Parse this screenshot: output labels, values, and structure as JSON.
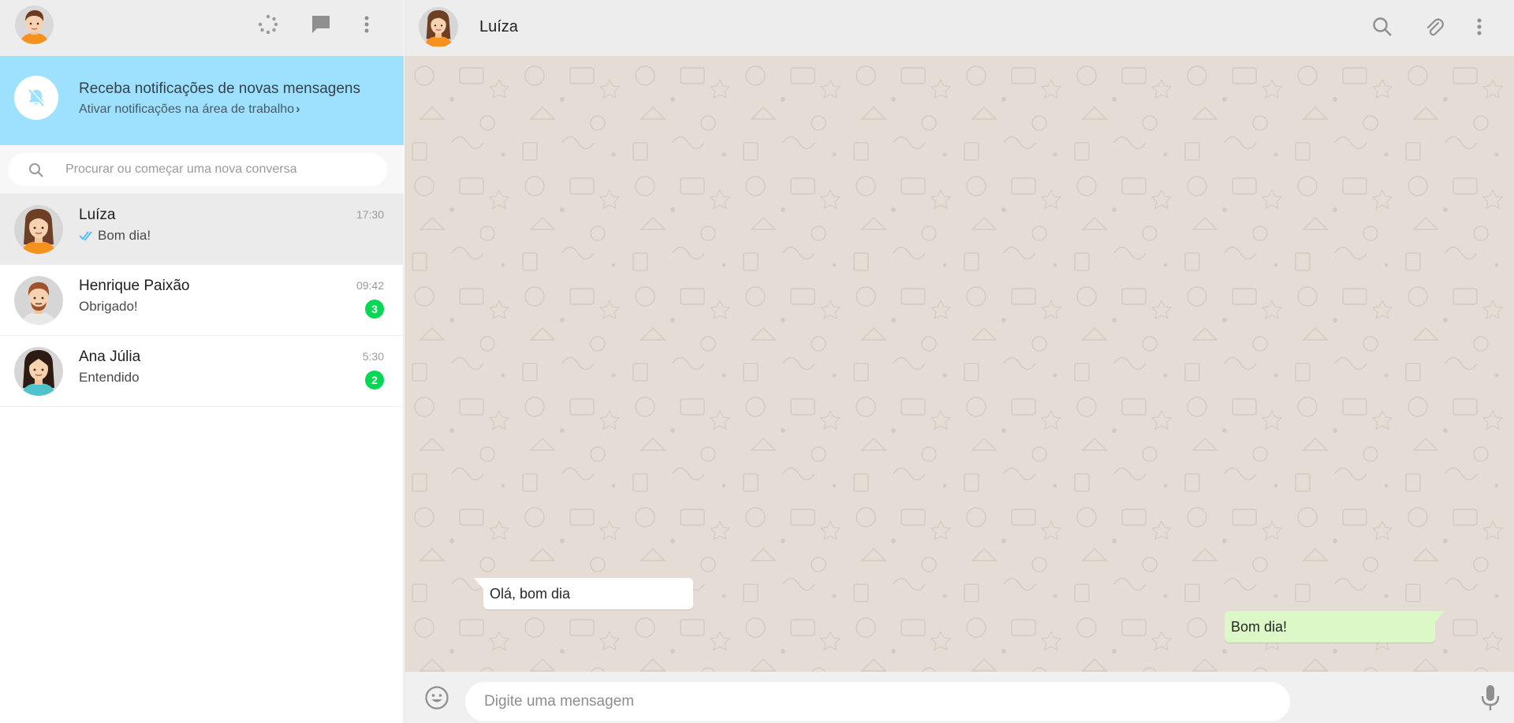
{
  "left_header": {
    "icons": [
      "user-avatar-icon",
      "status-icon",
      "new-chat-icon",
      "menu-icon"
    ]
  },
  "notification": {
    "title": "Receba notificações de novas mensagens",
    "subtitle": "Ativar notificações na área de trabalho",
    "chevron": "›"
  },
  "search": {
    "placeholder": "Procurar ou começar uma nova conversa"
  },
  "chats": [
    {
      "name": "Luíza",
      "time": "17:30",
      "last_message": "Bom dia!",
      "read_ticks": true,
      "unread": null,
      "active": true
    },
    {
      "name": "Henrique Paixão",
      "time": "09:42",
      "last_message": "Obrigado!",
      "read_ticks": false,
      "unread": "3",
      "active": false
    },
    {
      "name": "Ana Júlia",
      "time": "5:30",
      "last_message": "Entendido",
      "read_ticks": false,
      "unread": "2",
      "active": false
    }
  ],
  "conversation_header": {
    "contact_name": "Luíza"
  },
  "messages": [
    {
      "direction": "incoming",
      "text": "Olá, bom dia"
    },
    {
      "direction": "outgoing",
      "text": "Bom dia!"
    }
  ],
  "composer": {
    "placeholder": "Digite uma mensagem"
  },
  "colors": {
    "notification_bg": "#9de1fe",
    "badge": "#06d755",
    "outgoing_bubble": "#dcf8c6",
    "wallpaper": "#e5ddd5",
    "read_tick": "#4fc3f7"
  }
}
